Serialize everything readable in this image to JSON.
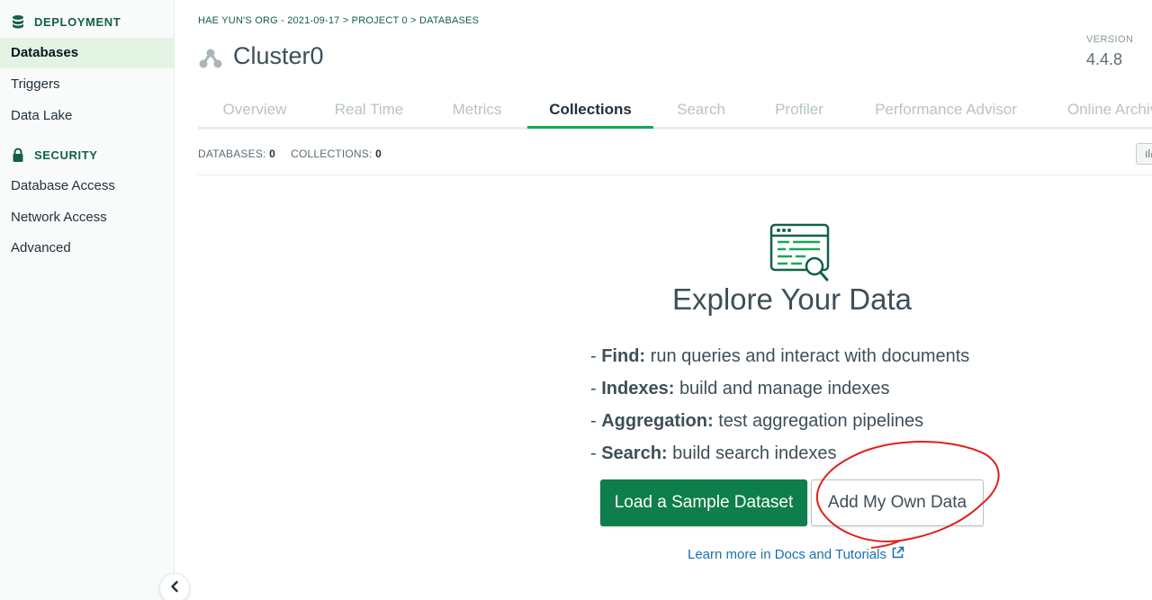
{
  "sidebar": {
    "deployment_header": "DEPLOYMENT",
    "deployment_items": [
      {
        "label": "Databases",
        "active": true
      },
      {
        "label": "Triggers",
        "active": false
      },
      {
        "label": "Data Lake",
        "active": false
      }
    ],
    "security_header": "SECURITY",
    "security_items": [
      {
        "label": "Database Access"
      },
      {
        "label": "Network Access"
      },
      {
        "label": "Advanced"
      }
    ]
  },
  "breadcrumb": {
    "org": "HAE YUN'S ORG - 2021-09-17",
    "sep": ">",
    "project": "PROJECT 0",
    "page": "DATABASES"
  },
  "header": {
    "cluster_name": "Cluster0",
    "version_label": "VERSION",
    "version_value": "4.4.8"
  },
  "tabs": [
    {
      "label": "Overview"
    },
    {
      "label": "Real Time"
    },
    {
      "label": "Metrics"
    },
    {
      "label": "Collections",
      "active": true
    },
    {
      "label": "Search"
    },
    {
      "label": "Profiler"
    },
    {
      "label": "Performance Advisor"
    },
    {
      "label": "Online Archive"
    }
  ],
  "stats": {
    "databases_label": "DATABASES:",
    "databases_value": "0",
    "collections_label": "COLLECTIONS:",
    "collections_value": "0"
  },
  "empty_state": {
    "title": "Explore Your Data",
    "features": [
      {
        "name": "Find:",
        "desc": "run queries and interact with documents"
      },
      {
        "name": "Indexes:",
        "desc": "build and manage indexes"
      },
      {
        "name": "Aggregation:",
        "desc": "test aggregation pipelines"
      },
      {
        "name": "Search:",
        "desc": "build search indexes"
      }
    ],
    "primary_button": "Load a Sample Dataset",
    "secondary_button": "Add My Own Data",
    "learn_link": "Learn more in Docs and Tutorials"
  },
  "colors": {
    "brand_green": "#116149",
    "button_green": "#0e7e4a",
    "tab_active_underline": "#13aa52",
    "link_blue": "#1a6fae",
    "annotation_red": "#e0201b"
  },
  "icons": {
    "deployment": "database-icon",
    "security": "lock-icon",
    "cluster": "cluster-icon",
    "explore": "data-explorer-icon",
    "external": "external-link-icon",
    "collapse": "chevron-left-icon"
  }
}
